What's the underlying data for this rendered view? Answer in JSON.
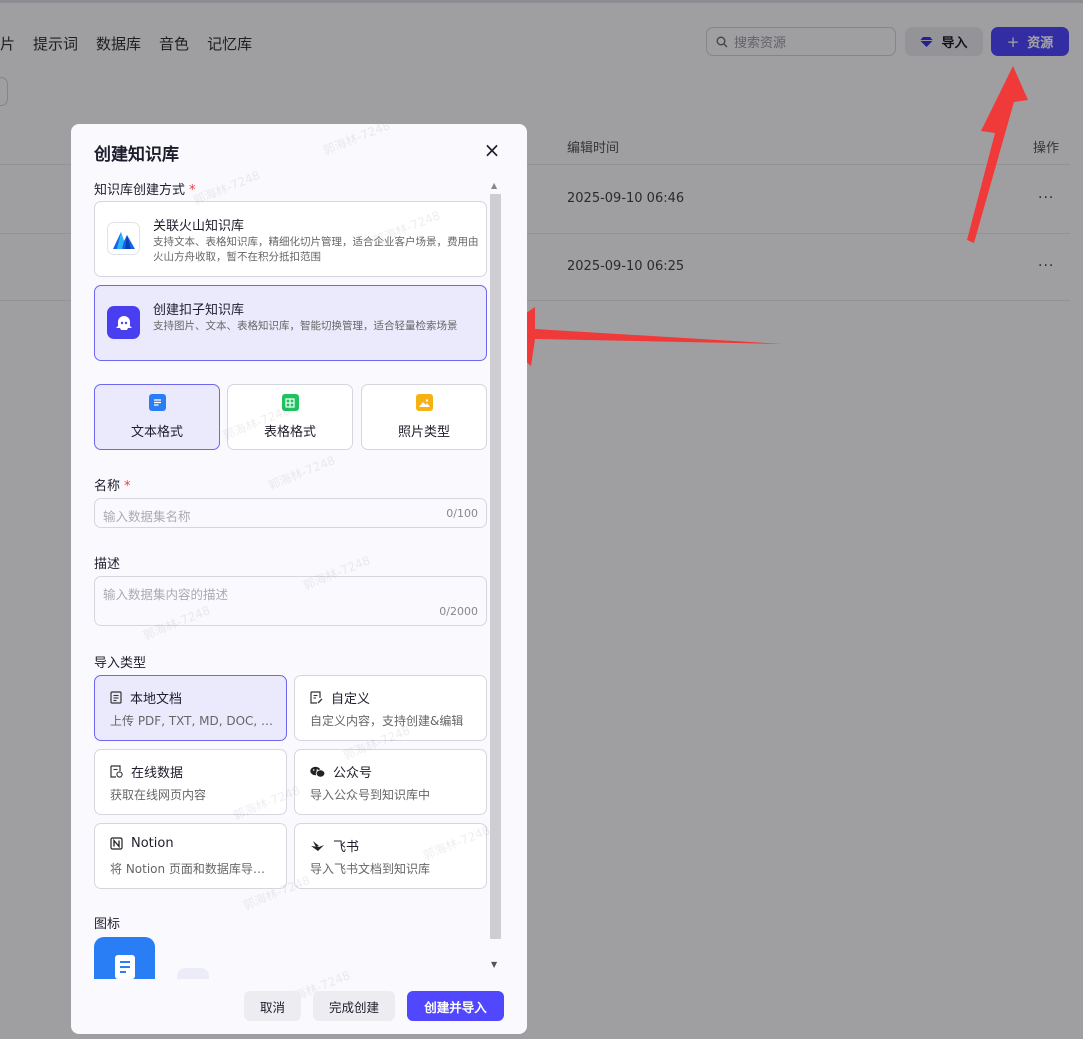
{
  "topnav": [
    "片",
    "提示词",
    "数据库",
    "音色",
    "记忆库"
  ],
  "search": {
    "placeholder": "搜索资源"
  },
  "header_buttons": {
    "import_label": "导入",
    "resource_label": "资源"
  },
  "table": {
    "edit_time_header": "编辑时间",
    "ops_header": "操作",
    "rows": [
      {
        "edit_time": "2025-09-10 06:46",
        "ops": "···"
      },
      {
        "edit_time": "2025-09-10 06:25",
        "ops": "···"
      }
    ]
  },
  "watermark": "郭海林-7248",
  "dialog": {
    "title": "创建知识库",
    "close": "×",
    "method_label": "知识库创建方式",
    "required_mark": "*",
    "methods": [
      {
        "title": "关联火山知识库",
        "desc": "支持文本、表格知识库，精细化切片管理，适合企业客户场景，费用由火山方舟收取，暂不在积分抵扣范围"
      },
      {
        "title": "创建扣子知识库",
        "desc": "支持图片、文本、表格知识库，智能切换管理，适合轻量检索场景"
      }
    ],
    "formats": [
      "文本格式",
      "表格格式",
      "照片类型"
    ],
    "name_label": "名称",
    "name_placeholder": "输入数据集名称",
    "name_counter": "0/100",
    "desc_label": "描述",
    "desc_placeholder": "输入数据集内容的描述",
    "desc_counter": "0/2000",
    "import_label": "导入类型",
    "import_types": [
      {
        "title": "本地文档",
        "desc": "上传 PDF, TXT, MD, DOC, DOCX 格式的本地文件"
      },
      {
        "title": "自定义",
        "desc": "自定义内容，支持创建&编辑"
      },
      {
        "title": "在线数据",
        "desc": "获取在线网页内容"
      },
      {
        "title": "公众号",
        "desc": "导入公众号到知识库中"
      },
      {
        "title": "Notion",
        "desc": "将 Notion 页面和数据库导入到知识库中"
      },
      {
        "title": "飞书",
        "desc": "导入飞书文档到知识库"
      }
    ],
    "icon_label": "图标",
    "buttons": {
      "cancel": "取消",
      "finish": "完成创建",
      "create_import": "创建并导入"
    }
  },
  "colors": {
    "primary": "#5147ff",
    "arrow": "#f03a3a",
    "selected_bg": "#eaeafc"
  }
}
